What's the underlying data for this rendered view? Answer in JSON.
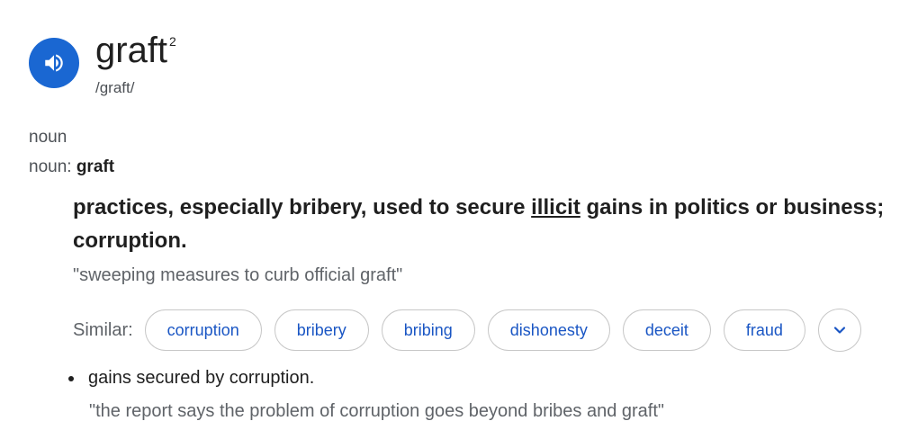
{
  "entry": {
    "word": "graft",
    "superscript": "2",
    "phonetic": "/graft/",
    "audio_icon": "speaker-icon"
  },
  "part_of_speech": "noun",
  "pos_line": {
    "prefix": "noun: ",
    "word": "graft"
  },
  "definition": {
    "before_link": "practices, especially bribery, used to secure ",
    "link": "illicit",
    "after_link": " gains in politics or business; corruption.",
    "example": "\"sweeping measures to curb official graft\""
  },
  "similar": {
    "label": "Similar:",
    "words": [
      "corruption",
      "bribery",
      "bribing",
      "dishonesty",
      "deceit",
      "fraud"
    ],
    "expand_icon": "chevron-down-icon"
  },
  "sub_definition": {
    "text": "gains secured by corruption.",
    "example": "\"the report says the problem of corruption goes beyond bribes and graft\""
  },
  "colors": {
    "accent": "#1a67d2",
    "chip_text": "#1a56c4",
    "text": "#1f1f1f",
    "muted": "#5f6368"
  }
}
